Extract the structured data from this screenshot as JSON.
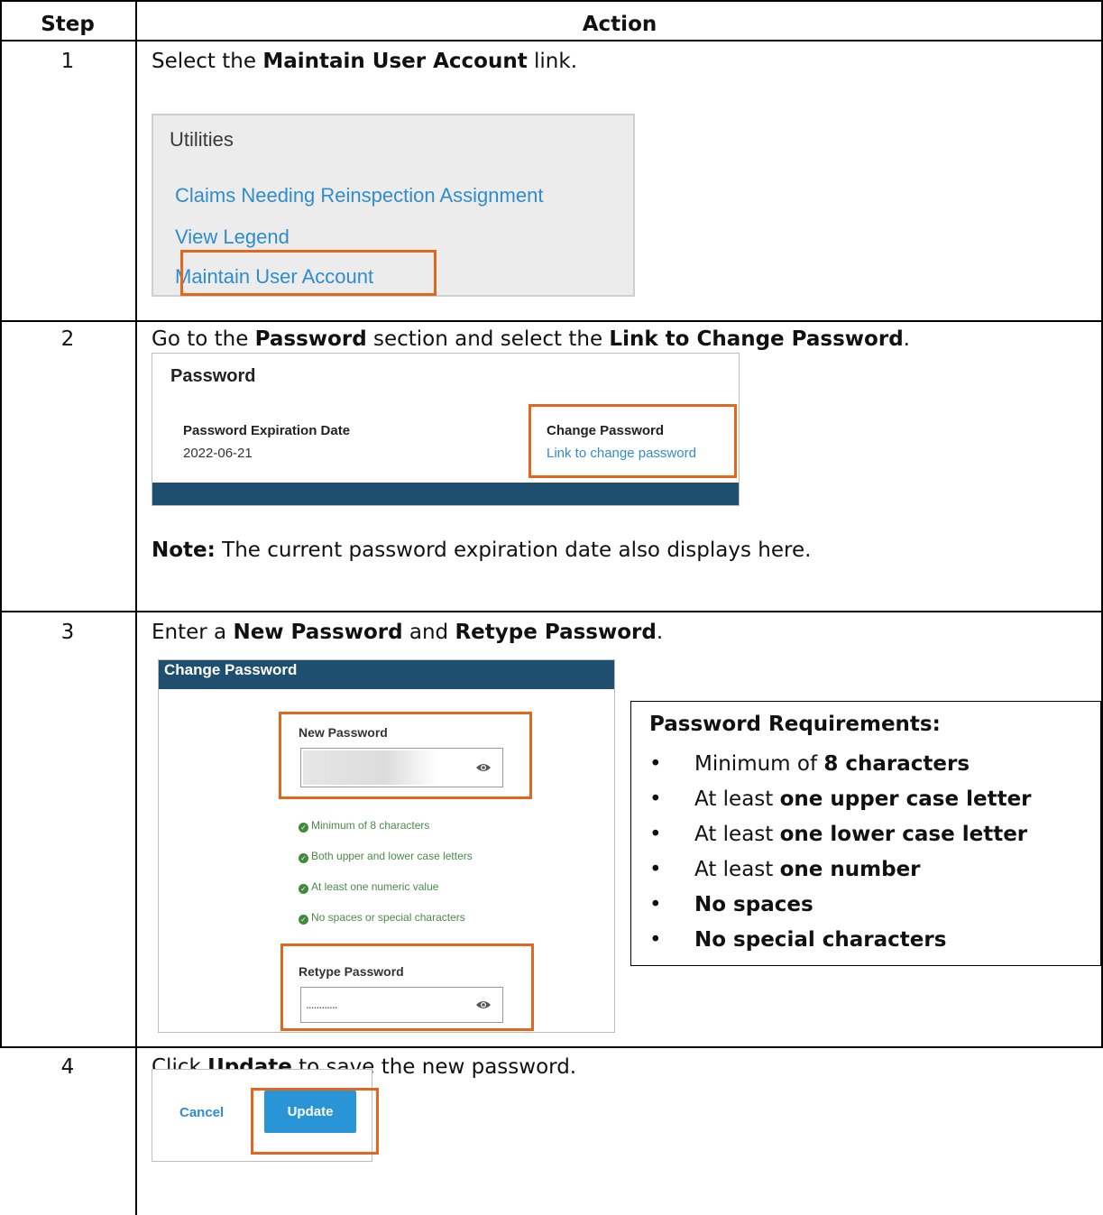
{
  "table": {
    "col_step": "Step",
    "col_action": "Action"
  },
  "steps": [
    {
      "number": "1",
      "pre": "Select the ",
      "bold1": "Maintain User Account",
      "post": " link."
    },
    {
      "number": "2",
      "pre": "Go to the ",
      "bold1": "Password",
      "mid": " section and select the ",
      "bold2": "Link to Change Password",
      "post": ".",
      "note_label": "Note:",
      "note_text": " The current password expiration date also displays here."
    },
    {
      "number": "3",
      "pre": "Enter a ",
      "bold1": "New Password",
      "mid": " and ",
      "bold2": "Retype Password",
      "post": "."
    },
    {
      "number": "4",
      "pre": "Click ",
      "bold1": "Update",
      "post": " to save the new password."
    }
  ],
  "utilities": {
    "title": "Utilities",
    "links": [
      "Claims Needing Reinspection Assignment",
      "View Legend",
      "Maintain User Account"
    ]
  },
  "password_section": {
    "title": "Password",
    "expiration_label": "Password Expiration Date",
    "expiration_value": "2022-06-21",
    "change_label": "Change Password",
    "change_link": "Link to change password"
  },
  "change_password": {
    "header": "Change Password",
    "new_label": "New Password",
    "retype_label": "Retype Password",
    "retype_value": "............",
    "rules": [
      "Minimum of 8 characters",
      "Both upper and lower case letters",
      "At least one numeric value",
      "No spaces or special characters"
    ]
  },
  "requirements": {
    "title": "Password Requirements:",
    "items": [
      {
        "pre": "Minimum of ",
        "bold": "8 characters"
      },
      {
        "pre": "At least ",
        "bold": "one upper case letter"
      },
      {
        "pre": "At least ",
        "bold": "one lower case letter"
      },
      {
        "pre": "At least ",
        "bold": "one number"
      },
      {
        "pre": "",
        "bold": "No spaces"
      },
      {
        "pre": "",
        "bold": "No special characters"
      }
    ]
  },
  "update_panel": {
    "cancel": "Cancel",
    "update": "Update"
  },
  "colors": {
    "highlight": "#e2661b",
    "link": "#2f8ccd",
    "header_blue": "#1e4f6e",
    "button_blue": "#2a95d6",
    "rule_green": "#4a8a47"
  }
}
